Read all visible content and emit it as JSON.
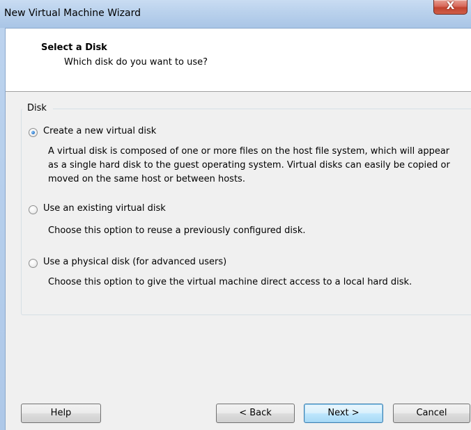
{
  "window": {
    "title": "New Virtual Machine Wizard",
    "close_glyph": "X"
  },
  "header": {
    "title": "Select a Disk",
    "subtitle": "Which disk do you want to use?"
  },
  "disk_group": {
    "label": "Disk",
    "options": [
      {
        "label": "Create a new virtual disk",
        "selected": true,
        "description": "A virtual disk is composed of one or more files on the host file system, which will appear as a single hard disk to the guest operating system. Virtual disks can easily be copied or moved on the same host or between hosts."
      },
      {
        "label": "Use an existing virtual disk",
        "selected": false,
        "description": "Choose this option to reuse a previously configured disk."
      },
      {
        "label": "Use a physical disk (for advanced users)",
        "selected": false,
        "description": "Choose this option to give the virtual machine direct access to a local hard disk."
      }
    ]
  },
  "buttons": {
    "help": "Help",
    "back": "< Back",
    "next": "Next >",
    "cancel": "Cancel"
  },
  "colors": {
    "title_bar": "#b9d1ec",
    "close_button": "#c2432f",
    "default_button_border": "#3c7fb1",
    "radio_selected": "#2c7bd0"
  }
}
